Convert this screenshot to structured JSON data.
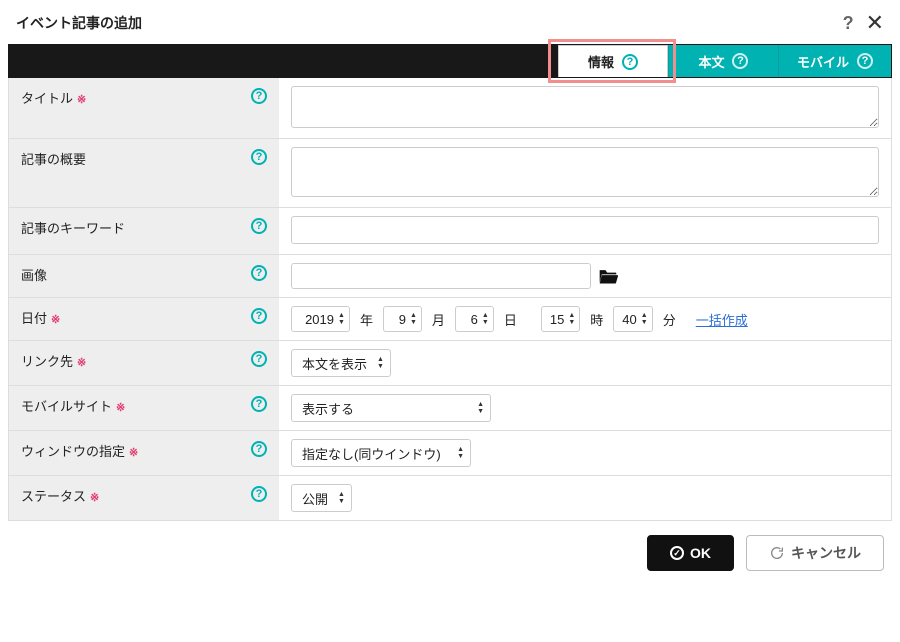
{
  "dialog": {
    "title": "イベント記事の追加"
  },
  "tabs": {
    "info": "情報",
    "body": "本文",
    "mobile": "モバイル"
  },
  "fields": {
    "title": {
      "label": "タイトル",
      "required": "※",
      "value": ""
    },
    "summary": {
      "label": "記事の概要",
      "value": ""
    },
    "keywords": {
      "label": "記事のキーワード",
      "value": ""
    },
    "image": {
      "label": "画像",
      "value": ""
    },
    "date": {
      "label": "日付",
      "required": "※",
      "year": "2019",
      "year_unit": "年",
      "month": "9",
      "month_unit": "月",
      "day": "6",
      "day_unit": "日",
      "hour": "15",
      "hour_unit": "時",
      "minute": "40",
      "minute_unit": "分",
      "batch_link": "一括作成"
    },
    "linkTarget": {
      "label": "リンク先",
      "required": "※",
      "value": "本文を表示"
    },
    "mobileSite": {
      "label": "モバイルサイト",
      "required": "※",
      "value": "表示する"
    },
    "windowSpec": {
      "label": "ウィンドウの指定",
      "required": "※",
      "value": "指定なし(同ウインドウ)"
    },
    "status": {
      "label": "ステータス",
      "required": "※",
      "value": "公開"
    }
  },
  "footer": {
    "ok": "OK",
    "cancel": "キャンセル"
  }
}
